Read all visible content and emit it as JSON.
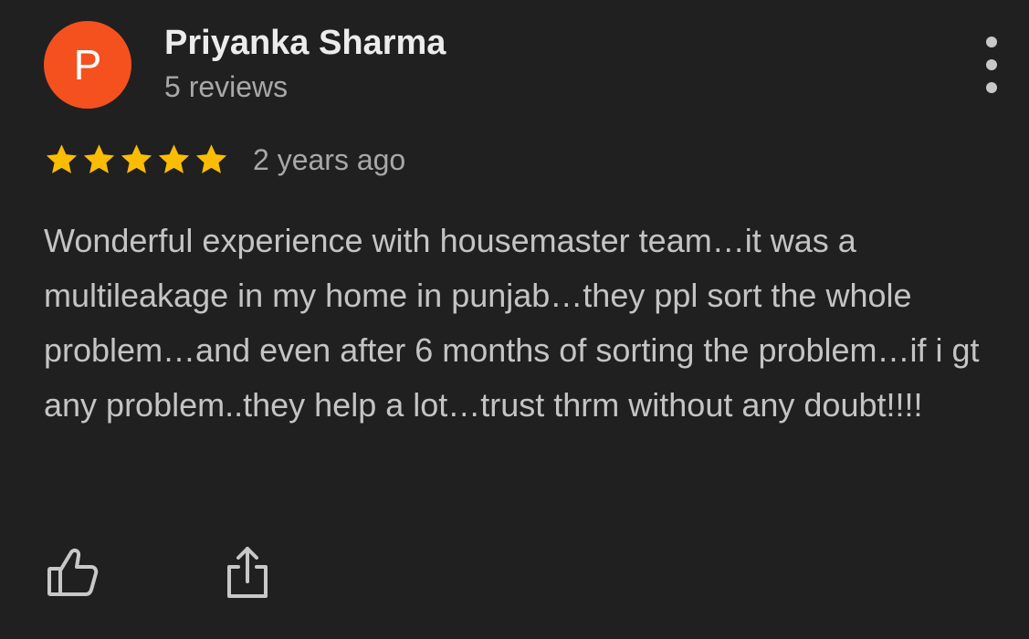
{
  "reviewer": {
    "initial": "P",
    "name": "Priyanka Sharma",
    "reviews_count": "5 reviews",
    "avatar_color": "#f4511e"
  },
  "rating": {
    "stars": 5,
    "max_stars": 5,
    "star_color": "#fbbc04",
    "time_ago": "2 years ago"
  },
  "review": {
    "text": "Wonderful experience with housemaster team…it was a multileakage in my home in punjab…they ppl sort the whole problem…and even after 6 months of sorting the problem…if i gt any problem..they help a lot…trust thrm without any doubt!!!!"
  },
  "icons": {
    "more": "more-vert-icon",
    "star": "star-icon",
    "like": "thumb-up-icon",
    "share": "share-icon"
  },
  "colors": {
    "background": "#202020",
    "icon": "#c8c8c8"
  }
}
